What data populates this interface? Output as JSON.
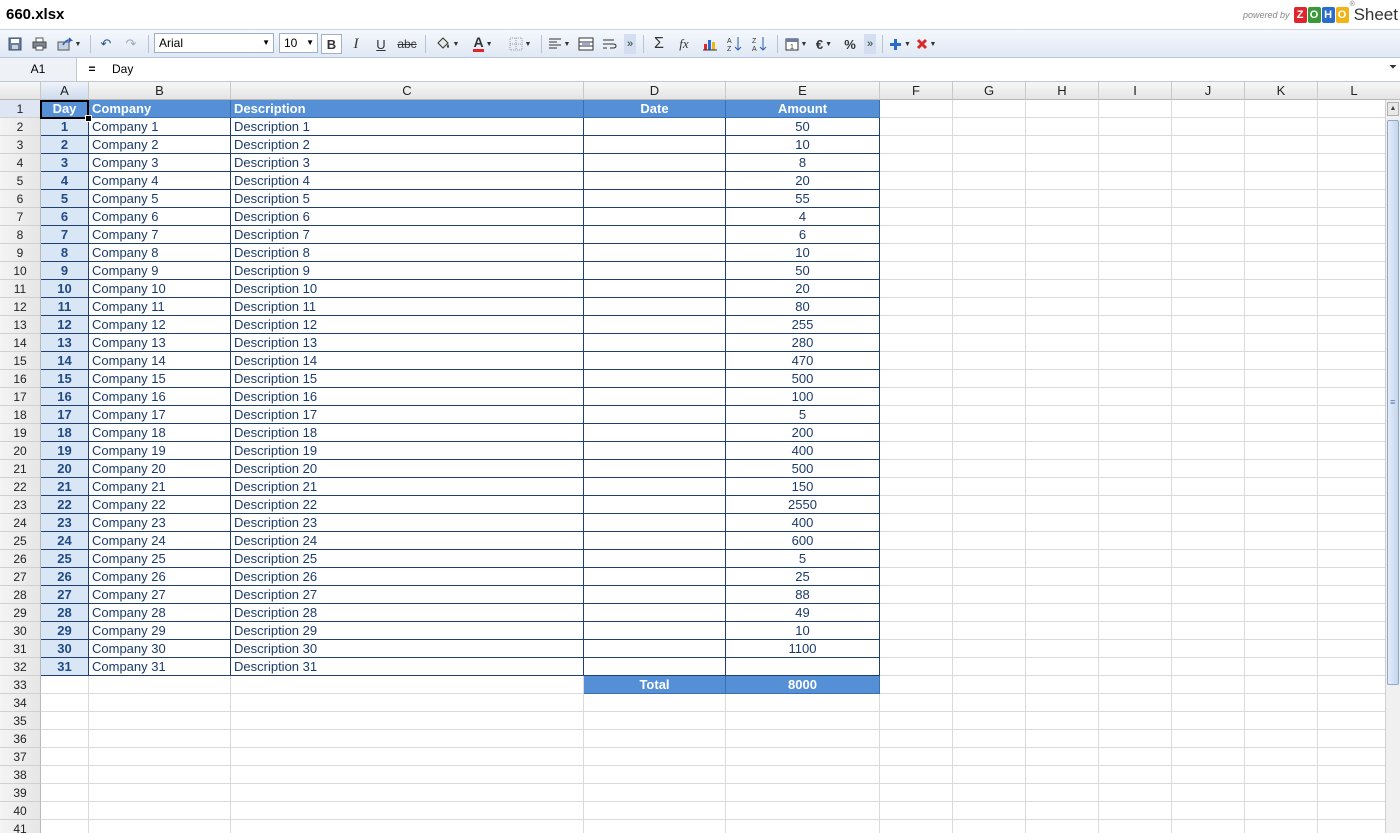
{
  "window": {
    "title": "660.xlsx"
  },
  "brand": {
    "powered_by": "powered by",
    "logo_letters": [
      "Z",
      "O",
      "H",
      "O"
    ],
    "logo_colors": [
      "#e0262c",
      "#3a9a3a",
      "#2a6ccc",
      "#f2b316"
    ],
    "product": "Sheet",
    "reg_mark": "®"
  },
  "toolbar": {
    "font_name": "Arial",
    "font_size": "10",
    "bold": "B",
    "italic": "I",
    "underline": "U",
    "strike": "abc",
    "sum": "Σ",
    "fx": "fx",
    "currency": "€",
    "percent": "%",
    "more": "»"
  },
  "formula_bar": {
    "cell_ref": "A1",
    "equals": "=",
    "content": "Day"
  },
  "columns": [
    "A",
    "B",
    "C",
    "D",
    "E",
    "F",
    "G",
    "H",
    "I",
    "J",
    "K",
    "L"
  ],
  "rows": [
    "1",
    "2",
    "3",
    "4",
    "5",
    "6",
    "7",
    "8",
    "9",
    "10",
    "11",
    "12",
    "13",
    "14",
    "15",
    "16",
    "17",
    "18",
    "19",
    "20",
    "21",
    "22",
    "23",
    "24",
    "25",
    "26",
    "27",
    "28",
    "29",
    "30",
    "31",
    "32",
    "33",
    "34",
    "35",
    "36",
    "37",
    "38",
    "39",
    "40",
    "41"
  ],
  "table": {
    "headers": [
      "Day",
      "Company",
      "Description",
      "Date",
      "Amount"
    ],
    "rows": [
      [
        "1",
        "Company 1",
        "Description 1",
        "",
        "50"
      ],
      [
        "2",
        "Company 2",
        "Description 2",
        "",
        "10"
      ],
      [
        "3",
        "Company 3",
        "Description 3",
        "",
        "8"
      ],
      [
        "4",
        "Company 4",
        "Description 4",
        "",
        "20"
      ],
      [
        "5",
        "Company 5",
        "Description 5",
        "",
        "55"
      ],
      [
        "6",
        "Company 6",
        "Description 6",
        "",
        "4"
      ],
      [
        "7",
        "Company 7",
        "Description 7",
        "",
        "6"
      ],
      [
        "8",
        "Company 8",
        "Description 8",
        "",
        "10"
      ],
      [
        "9",
        "Company 9",
        "Description 9",
        "",
        "50"
      ],
      [
        "10",
        "Company 10",
        "Description 10",
        "",
        "20"
      ],
      [
        "11",
        "Company 11",
        "Description 11",
        "",
        "80"
      ],
      [
        "12",
        "Company 12",
        "Description 12",
        "",
        "255"
      ],
      [
        "13",
        "Company 13",
        "Description 13",
        "",
        "280"
      ],
      [
        "14",
        "Company 14",
        "Description 14",
        "",
        "470"
      ],
      [
        "15",
        "Company 15",
        "Description 15",
        "",
        "500"
      ],
      [
        "16",
        "Company 16",
        "Description 16",
        "",
        "100"
      ],
      [
        "17",
        "Company 17",
        "Description 17",
        "",
        "5"
      ],
      [
        "18",
        "Company 18",
        "Description 18",
        "",
        "200"
      ],
      [
        "19",
        "Company 19",
        "Description 19",
        "",
        "400"
      ],
      [
        "20",
        "Company 20",
        "Description 20",
        "",
        "500"
      ],
      [
        "21",
        "Company 21",
        "Description 21",
        "",
        "150"
      ],
      [
        "22",
        "Company 22",
        "Description 22",
        "",
        "2550"
      ],
      [
        "23",
        "Company 23",
        "Description 23",
        "",
        "400"
      ],
      [
        "24",
        "Company 24",
        "Description 24",
        "",
        "600"
      ],
      [
        "25",
        "Company 25",
        "Description 25",
        "",
        "5"
      ],
      [
        "26",
        "Company 26",
        "Description 26",
        "",
        "25"
      ],
      [
        "27",
        "Company 27",
        "Description 27",
        "",
        "88"
      ],
      [
        "28",
        "Company 28",
        "Description 28",
        "",
        "49"
      ],
      [
        "29",
        "Company 29",
        "Description 29",
        "",
        "10"
      ],
      [
        "30",
        "Company 30",
        "Description 30",
        "",
        "1100"
      ],
      [
        "31",
        "Company 31",
        "Description 31",
        "",
        ""
      ]
    ],
    "total_label": "Total",
    "total_value": "8000"
  },
  "colors": {
    "header_fill": "#5590d6",
    "day_fill": "#d9e6f5",
    "border": "#1f3f73",
    "text": "#1b3a6a"
  }
}
